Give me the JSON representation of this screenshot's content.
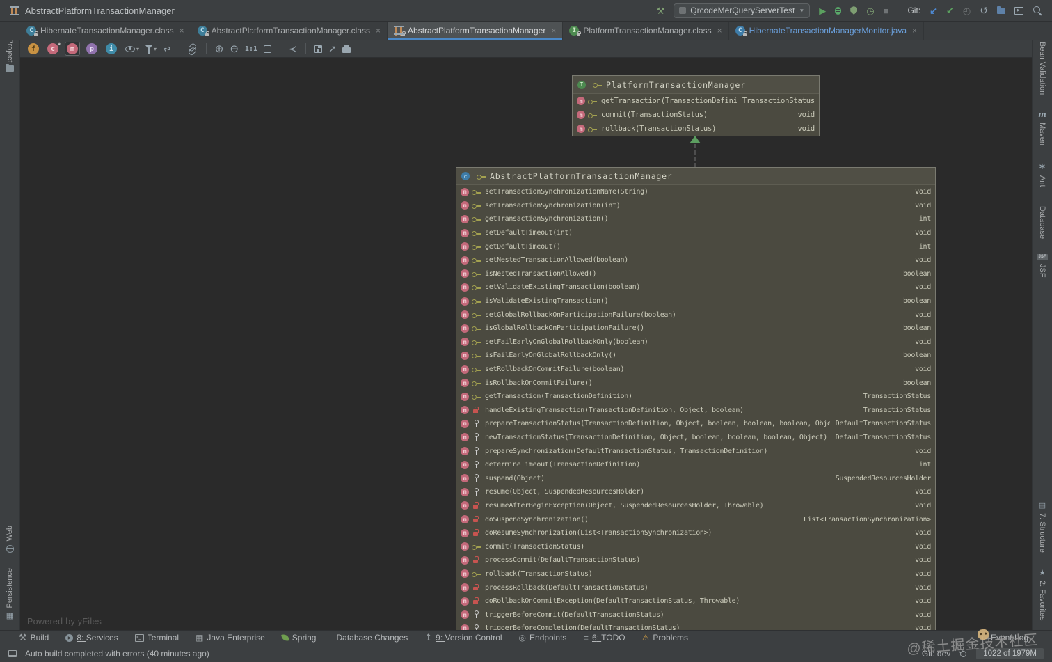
{
  "window": {
    "title": "AbstractPlatformTransactionManager"
  },
  "titlebar": {
    "run_config": "QrcodeMerQueryServerTest",
    "git_label": "Git:"
  },
  "tabs": [
    {
      "name": "tab-hibernate-transaction-manager-class",
      "label": "HibernateTransactionManager.class",
      "icon": "ic-class",
      "state": "",
      "close": "×"
    },
    {
      "name": "tab-abstract-platform-transaction-manager-class",
      "label": "AbstractPlatformTransactionManager.class",
      "icon": "ic-class",
      "state": "",
      "close": "×"
    },
    {
      "name": "tab-abstract-platform-transaction-manager-diagram",
      "label": "AbstractPlatformTransactionManager",
      "icon": "ic-diagram",
      "state": "active",
      "close": "×"
    },
    {
      "name": "tab-platform-transaction-manager-class",
      "label": "PlatformTransactionManager.class",
      "icon": "ic-interface",
      "state": "",
      "close": "×"
    },
    {
      "name": "tab-hibernate-transaction-manager-monitor-java",
      "label": "HibernateTransactionManagerMonitor.java",
      "icon": "ic-javaclass",
      "state": "blue",
      "close": "×"
    }
  ],
  "diagram_toolbar": {
    "zoom_reset_label": "1:1",
    "toggles": [
      {
        "name": "fields-toggle",
        "letter": "f",
        "cls": "tg-f",
        "state": ""
      },
      {
        "name": "constructors-toggle",
        "letter": "c",
        "cls": "tg-c",
        "state": ""
      },
      {
        "name": "methods-toggle",
        "letter": "m",
        "cls": "tg-m",
        "state": "selected"
      },
      {
        "name": "properties-toggle",
        "letter": "p",
        "cls": "tg-p",
        "state": ""
      },
      {
        "name": "inner-classes-toggle",
        "letter": "i",
        "cls": "tg-i",
        "state": ""
      }
    ]
  },
  "left_stripe": {
    "top": [
      {
        "name": "tool-button-project",
        "label": "1: Project",
        "icon": "si-folder",
        "pos": ""
      }
    ],
    "bottom": [
      {
        "name": "tool-button-web",
        "label": "Web",
        "icon": "si-globe",
        "pos": "icon-below"
      },
      {
        "name": "tool-button-persistence",
        "label": "Persistence",
        "icon": "si-persistence",
        "pos": "icon-below"
      }
    ]
  },
  "right_stripe": {
    "top": [
      {
        "name": "tool-button-bean-validation",
        "label": "Bean Validation",
        "icon": "si-bean",
        "pos": ""
      },
      {
        "name": "tool-button-maven",
        "label": "Maven",
        "icon": "si-maven",
        "pos": ""
      },
      {
        "name": "tool-button-ant",
        "label": "Ant",
        "icon": "si-ant",
        "pos": ""
      },
      {
        "name": "tool-button-database",
        "label": "Database",
        "icon": "si-db",
        "pos": ""
      },
      {
        "name": "tool-button-jsf",
        "label": "JSF",
        "icon": "si-jsf",
        "pos": ""
      }
    ],
    "bottom": [
      {
        "name": "tool-button-structure",
        "label": "7: Structure",
        "icon": "si-structure",
        "pos": ""
      },
      {
        "name": "tool-button-favorites",
        "label": "2: Favorites",
        "icon": "si-favorites",
        "pos": ""
      }
    ]
  },
  "diagram": {
    "powered_by": "Powered by yFiles",
    "interface_box": {
      "name": "PlatformTransactionManager",
      "methods": [
        {
          "sig": "getTransaction(TransactionDefinition)",
          "ret": "TransactionStatus",
          "vis": "vis-public"
        },
        {
          "sig": "commit(TransactionStatus)",
          "ret": "void",
          "vis": "vis-public"
        },
        {
          "sig": "rollback(TransactionStatus)",
          "ret": "void",
          "vis": "vis-public"
        }
      ]
    },
    "class_box": {
      "name": "AbstractPlatformTransactionManager",
      "methods": [
        {
          "sig": "setTransactionSynchronizationName(String)",
          "ret": "void",
          "vis": "vis-public"
        },
        {
          "sig": "setTransactionSynchronization(int)",
          "ret": "void",
          "vis": "vis-public"
        },
        {
          "sig": "getTransactionSynchronization()",
          "ret": "int",
          "vis": "vis-public"
        },
        {
          "sig": "setDefaultTimeout(int)",
          "ret": "void",
          "vis": "vis-public"
        },
        {
          "sig": "getDefaultTimeout()",
          "ret": "int",
          "vis": "vis-public"
        },
        {
          "sig": "setNestedTransactionAllowed(boolean)",
          "ret": "void",
          "vis": "vis-public"
        },
        {
          "sig": "isNestedTransactionAllowed()",
          "ret": "boolean",
          "vis": "vis-public"
        },
        {
          "sig": "setValidateExistingTransaction(boolean)",
          "ret": "void",
          "vis": "vis-public"
        },
        {
          "sig": "isValidateExistingTransaction()",
          "ret": "boolean",
          "vis": "vis-public"
        },
        {
          "sig": "setGlobalRollbackOnParticipationFailure(boolean)",
          "ret": "void",
          "vis": "vis-public"
        },
        {
          "sig": "isGlobalRollbackOnParticipationFailure()",
          "ret": "boolean",
          "vis": "vis-public"
        },
        {
          "sig": "setFailEarlyOnGlobalRollbackOnly(boolean)",
          "ret": "void",
          "vis": "vis-public"
        },
        {
          "sig": "isFailEarlyOnGlobalRollbackOnly()",
          "ret": "boolean",
          "vis": "vis-public"
        },
        {
          "sig": "setRollbackOnCommitFailure(boolean)",
          "ret": "void",
          "vis": "vis-public"
        },
        {
          "sig": "isRollbackOnCommitFailure()",
          "ret": "boolean",
          "vis": "vis-public"
        },
        {
          "sig": "getTransaction(TransactionDefinition)",
          "ret": "TransactionStatus",
          "vis": "vis-public"
        },
        {
          "sig": "handleExistingTransaction(TransactionDefinition, Object, boolean)",
          "ret": "TransactionStatus",
          "vis": "vis-private"
        },
        {
          "sig": "prepareTransactionStatus(TransactionDefinition, Object, boolean, boolean, boolean, Object)",
          "ret": "DefaultTransactionStatus",
          "vis": "vis-protected"
        },
        {
          "sig": "newTransactionStatus(TransactionDefinition, Object, boolean, boolean, boolean, Object)",
          "ret": "DefaultTransactionStatus",
          "vis": "vis-protected"
        },
        {
          "sig": "prepareSynchronization(DefaultTransactionStatus, TransactionDefinition)",
          "ret": "void",
          "vis": "vis-protected"
        },
        {
          "sig": "determineTimeout(TransactionDefinition)",
          "ret": "int",
          "vis": "vis-protected"
        },
        {
          "sig": "suspend(Object)",
          "ret": "SuspendedResourcesHolder",
          "vis": "vis-protected"
        },
        {
          "sig": "resume(Object, SuspendedResourcesHolder)",
          "ret": "void",
          "vis": "vis-protected"
        },
        {
          "sig": "resumeAfterBeginException(Object, SuspendedResourcesHolder, Throwable)",
          "ret": "void",
          "vis": "vis-private"
        },
        {
          "sig": "doSuspendSynchronization()",
          "ret": "List<TransactionSynchronization>",
          "vis": "vis-private"
        },
        {
          "sig": "doResumeSynchronization(List<TransactionSynchronization>)",
          "ret": "void",
          "vis": "vis-private"
        },
        {
          "sig": "commit(TransactionStatus)",
          "ret": "void",
          "vis": "vis-public"
        },
        {
          "sig": "processCommit(DefaultTransactionStatus)",
          "ret": "void",
          "vis": "vis-private"
        },
        {
          "sig": "rollback(TransactionStatus)",
          "ret": "void",
          "vis": "vis-public"
        },
        {
          "sig": "processRollback(DefaultTransactionStatus)",
          "ret": "void",
          "vis": "vis-private"
        },
        {
          "sig": "doRollbackOnCommitException(DefaultTransactionStatus, Throwable)",
          "ret": "void",
          "vis": "vis-private"
        },
        {
          "sig": "triggerBeforeCommit(DefaultTransactionStatus)",
          "ret": "void",
          "vis": "vis-protected"
        },
        {
          "sig": "triggerBeforeCompletion(DefaultTransactionStatus)",
          "ret": "void",
          "vis": "vis-protected"
        }
      ]
    }
  },
  "bottom_bar": {
    "items": [
      {
        "name": "tool-button-build",
        "shortcut": "",
        "label": "Build",
        "icon": "bi-build"
      },
      {
        "name": "tool-button-services",
        "shortcut": "8",
        "label": "Services",
        "icon": "bi-services"
      },
      {
        "name": "tool-button-terminal",
        "shortcut": "",
        "label": "Terminal",
        "icon": "bi-terminal"
      },
      {
        "name": "tool-button-java-enterprise",
        "shortcut": "",
        "label": "Java Enterprise",
        "icon": "bi-javaee"
      },
      {
        "name": "tool-button-spring",
        "shortcut": "",
        "label": "Spring",
        "icon": "bi-spring"
      },
      {
        "name": "tool-button-database-changes",
        "shortcut": "",
        "label": "Database Changes",
        "icon": "bi-db"
      },
      {
        "name": "tool-button-version-control",
        "shortcut": "9",
        "label": "Version Control",
        "icon": "bi-vcs"
      },
      {
        "name": "tool-button-endpoints",
        "shortcut": "",
        "label": "Endpoints",
        "icon": "bi-endpoints"
      },
      {
        "name": "tool-button-todo",
        "shortcut": "6",
        "label": "TODO",
        "icon": "bi-todo"
      },
      {
        "name": "tool-button-problems",
        "shortcut": "",
        "label": "Problems",
        "icon": "bi-problems"
      }
    ],
    "event_log": "Event Log"
  },
  "status_bar": {
    "message": "Auto build completed with errors (40 minutes ago)",
    "git": "Git: dev",
    "memory": "1022 of 1979M"
  },
  "watermark": "@稀土掘金技术社区",
  "colors": {
    "accent_blue": "#4A88C7",
    "run_green": "#59A869",
    "private_red": "#C75450",
    "public_olive": "#A3A150",
    "box_bg": "#4B4A40",
    "chrome": "#3C3F41",
    "canvas": "#2A2A2A"
  }
}
